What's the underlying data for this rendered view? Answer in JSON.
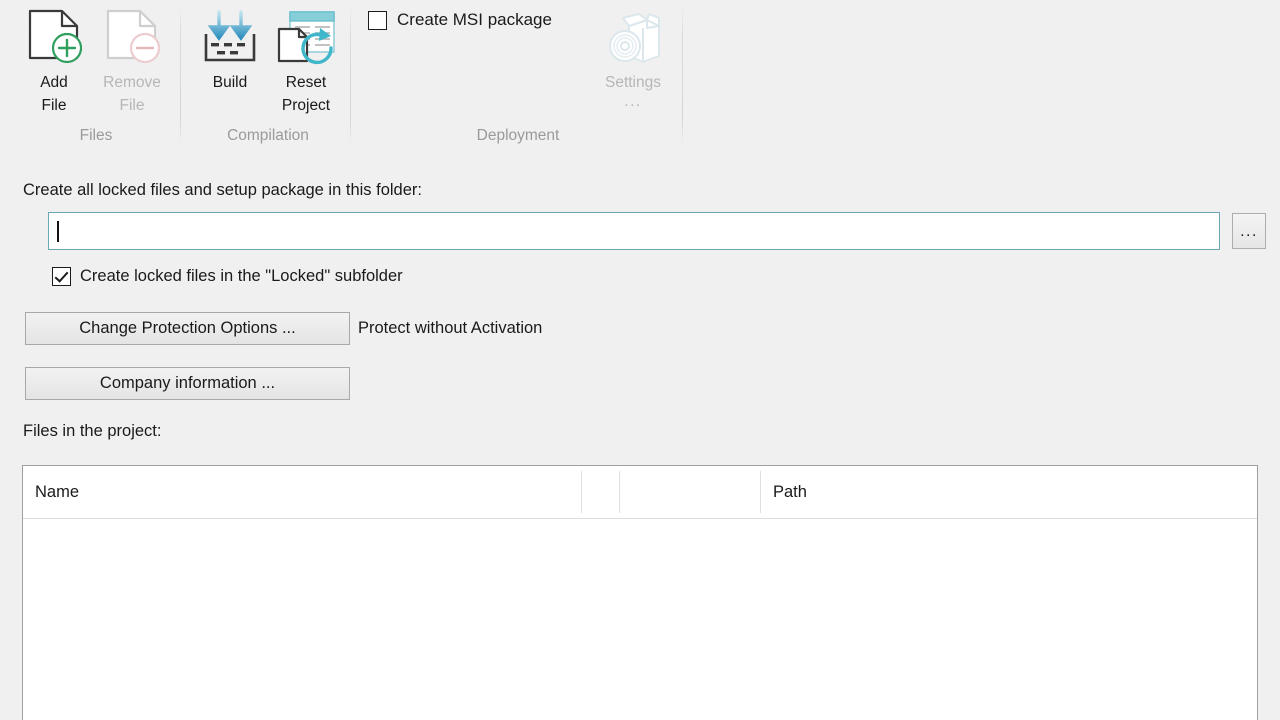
{
  "ribbon": {
    "groups": [
      {
        "name": "Files",
        "label": "Files"
      },
      {
        "name": "Compilation",
        "label": "Compilation"
      },
      {
        "name": "Deployment",
        "label": "Deployment"
      }
    ],
    "buttons": [
      {
        "id": "add-file",
        "label": "Add\nFile",
        "icon": "document-add-icon",
        "enabled": true
      },
      {
        "id": "remove-file",
        "label": "Remove\nFile",
        "icon": "document-remove-icon",
        "enabled": false
      },
      {
        "id": "build",
        "label": "Build",
        "icon": "build-download-icon",
        "enabled": true
      },
      {
        "id": "reset-project",
        "label": "Reset\nProject",
        "icon": "reset-refresh-icon",
        "enabled": true
      },
      {
        "id": "settings",
        "label": "Settings",
        "icon": "package-disc-icon",
        "enabled": false,
        "overflow": "..."
      }
    ],
    "msi_checkbox": {
      "label": "Create MSI package",
      "checked": false
    }
  },
  "main": {
    "folder_label": "Create all locked files and setup package in this folder:",
    "folder_input": {
      "value": "",
      "placeholder": ""
    },
    "browse_button": "...",
    "locked_subfolder_checkbox": {
      "label": "Create locked files in the \"Locked\" subfolder",
      "checked": true
    },
    "protection_button": "Change Protection Options ...",
    "protection_status": "Protect without Activation",
    "company_button": "Company information ...",
    "files_label": "Files in the project:"
  },
  "files_list": {
    "columns": [
      {
        "key": "name",
        "label": "Name"
      },
      {
        "key": "col2",
        "label": ""
      },
      {
        "key": "col3",
        "label": ""
      },
      {
        "key": "path",
        "label": "Path"
      }
    ],
    "rows": []
  },
  "colors": {
    "window_bg": "#f0f0f0",
    "accent_teal": "#5aa8b8",
    "accent_green": "#2f9e5e",
    "accent_blue": "#2e8fbe",
    "group_label": "#9a9a9a",
    "disabled_text": "#b6b6b6",
    "list_bg": "#ffffff"
  }
}
